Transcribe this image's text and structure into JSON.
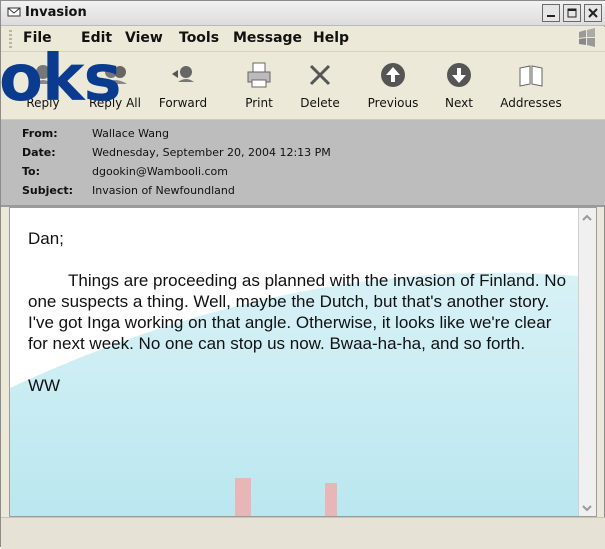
{
  "window": {
    "title": "Invasion",
    "menu": [
      "File",
      "Edit",
      "View",
      "Tools",
      "Message",
      "Help"
    ]
  },
  "toolbar": {
    "buttons": [
      {
        "label": "Reply",
        "icon": "reply-icon"
      },
      {
        "label": "Reply All",
        "icon": "reply-all-icon"
      },
      {
        "label": "Forward",
        "icon": "forward-icon"
      },
      {
        "label": "Print",
        "icon": "print-icon"
      },
      {
        "label": "Delete",
        "icon": "delete-icon"
      },
      {
        "label": "Previous",
        "icon": "previous-icon"
      },
      {
        "label": "Next",
        "icon": "next-icon"
      },
      {
        "label": "Addresses",
        "icon": "addresses-icon"
      }
    ]
  },
  "watermark": {
    "text": "oks"
  },
  "email": {
    "from_label": "From:",
    "from": "Wallace Wang",
    "date_label": "Date:",
    "date": "Wednesday, September 20, 2004 12:13 PM",
    "to_label": "To:",
    "to": "dgookin@Wambooli.com",
    "subject_label": "Subject:",
    "subject": "Invasion of Newfoundland",
    "body": {
      "greeting": "Dan;",
      "paragraph": "Things are proceeding as planned with the invasion of Finland. No one suspects a thing. Well, maybe the Dutch, but that's another story. I've got Inga working on that angle. Otherwise, it looks like we're clear for next week. No one can stop us now. Bwaa-ha-ha, and so forth.",
      "signature": "WW"
    }
  },
  "colors": {
    "header_bg": "#bdbdbd",
    "watermark": "#0a3b8f",
    "toolbar_bg": "#ece9d8"
  }
}
